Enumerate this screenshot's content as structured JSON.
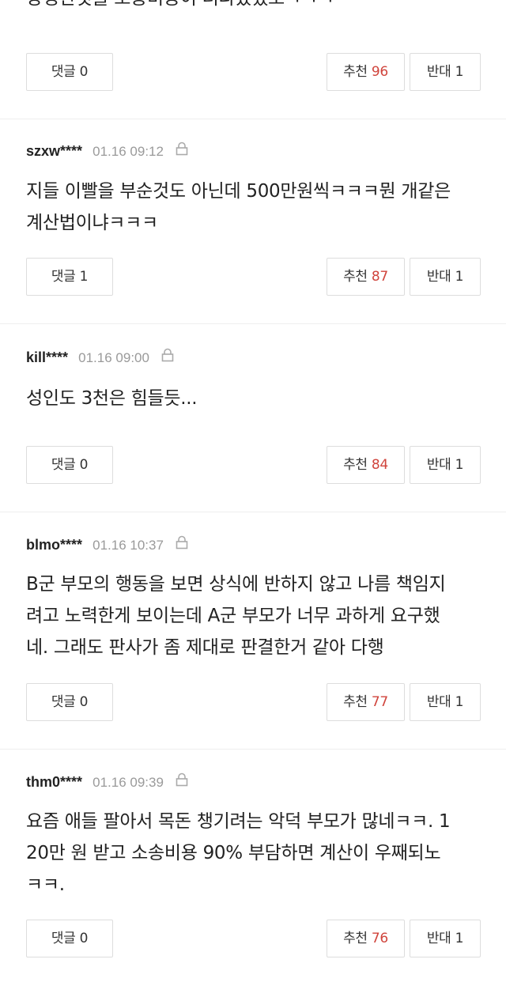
{
  "top_fragment": {
    "text": "방정한것을 소송비용이 더나왔겠노ㅋㅋㅋ",
    "buttons": {
      "reply_label": "댓글",
      "reply_count": "0",
      "up_label": "추천",
      "up_count": "96",
      "down_label": "반대",
      "down_count": "1"
    }
  },
  "comments": [
    {
      "user": "szxw****",
      "date": "01.16 09:12",
      "lines": [
        "지들 이빨을 부순것도 아닌데 500만원씩ㅋㅋㅋ뭔 개같은",
        "계산법이냐ㅋㅋㅋ"
      ],
      "buttons": {
        "reply_label": "댓글",
        "reply_count": "1",
        "up_label": "추천",
        "up_count": "87",
        "down_label": "반대",
        "down_count": "1"
      }
    },
    {
      "user": "kill****",
      "date": "01.16 09:00",
      "lines": [
        "성인도 3천은 힘들듯..."
      ],
      "buttons": {
        "reply_label": "댓글",
        "reply_count": "0",
        "up_label": "추천",
        "up_count": "84",
        "down_label": "반대",
        "down_count": "1"
      }
    },
    {
      "user": "blmo****",
      "date": "01.16 10:37",
      "lines": [
        "B군 부모의 행동을 보면 상식에 반하지 않고 나름 책임지",
        "려고 노력한게 보이는데 A군 부모가 너무 과하게 요구했",
        "네. 그래도 판사가 좀 제대로 판결한거 같아 다행"
      ],
      "buttons": {
        "reply_label": "댓글",
        "reply_count": "0",
        "up_label": "추천",
        "up_count": "77",
        "down_label": "반대",
        "down_count": "1"
      }
    },
    {
      "user": "thm0****",
      "date": "01.16 09:39",
      "lines": [
        "요즘 애들 팔아서 목돈 챙기려는 악덕 부모가 많네ㅋㅋ. 1",
        "20만 원 받고 소송비용 90% 부담하면 계산이 우째되노",
        "ㅋㅋ."
      ],
      "buttons": {
        "reply_label": "댓글",
        "reply_count": "0",
        "up_label": "추천",
        "up_count": "76",
        "down_label": "반대",
        "down_count": "1"
      }
    }
  ],
  "icons": {
    "lock": "lock-icon"
  },
  "colors": {
    "accent_count": "#d0443c",
    "date": "#9a9a9a",
    "border": "#dddddd",
    "divider": "#eeeeee"
  }
}
